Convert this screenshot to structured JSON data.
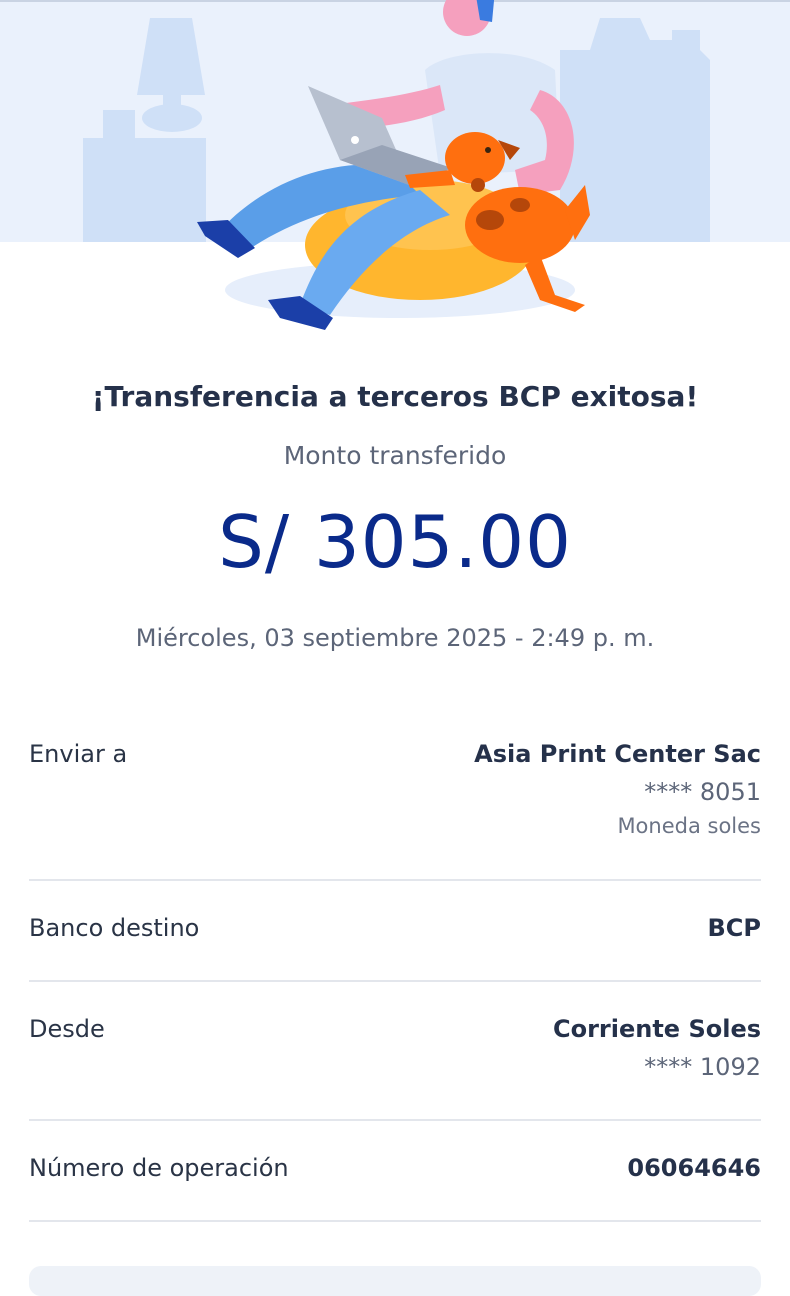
{
  "header": {
    "illustration": "person-with-laptop-and-dog-illustration"
  },
  "receipt": {
    "title": "¡Transferencia a terceros BCP exitosa!",
    "amount_label": "Monto transferido",
    "amount": "S/ 305.00",
    "datetime": "Miércoles, 03 septiembre 2025 - 2:49 p. m."
  },
  "details": {
    "send_to": {
      "label": "Enviar a",
      "name": "Asia Print Center Sac",
      "account": "**** 8051",
      "currency": "Moneda soles"
    },
    "bank": {
      "label": "Banco destino",
      "value": "BCP"
    },
    "from": {
      "label": "Desde",
      "account_type": "Corriente Soles",
      "account": "**** 1092"
    },
    "operation": {
      "label": "Número de operación",
      "value": "06064646"
    }
  },
  "colors": {
    "amount": "#0a2a8a",
    "hero_bg": "#eaf1fc",
    "dog": "#ff6f0f",
    "chair": "#ffb62e"
  }
}
